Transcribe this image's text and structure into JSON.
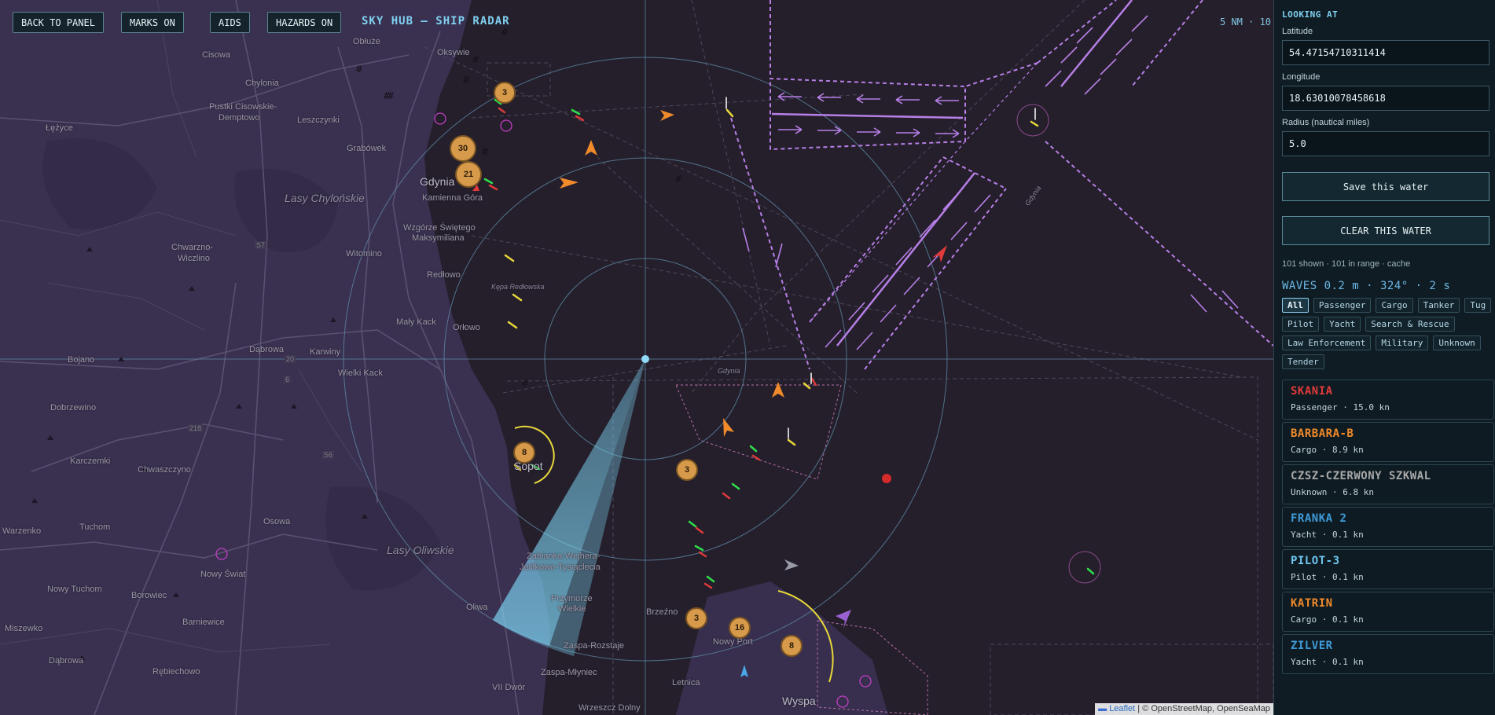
{
  "toolbar": {
    "back_label": "BACK TO PANEL",
    "marks_label": "MARKS ON",
    "aids_label": "AIDS",
    "hazards_label": "HAZARDS ON",
    "app_title": "SKY HUB — SHIP RADAR",
    "range_readout": "5 NM · 10"
  },
  "map": {
    "places": {
      "obluze": "Obłuże",
      "oksywie": "Oksywie",
      "cisowa": "Cisowa",
      "chylonia": "Chylonia",
      "pustki": "Pustki Cisowskie-",
      "demptowo": "Demptowo",
      "leszczynki": "Leszczynki",
      "lezyce": "Łężyce",
      "grabowek": "Grabówek",
      "gdynia": "Gdynia",
      "kamienna_gora": "Kamienna Góra",
      "lasy_chylonskie": "Lasy Chylońskie",
      "wzgorze": "Wzgórze Świętego",
      "maksymiliana": "Maksymiliana",
      "chwarzno": "Chwarzno-",
      "wiczlino": "Wiczlino",
      "witomino": "Witomino",
      "redlowo": "Redłowo",
      "kepa": "Kępa Redłowska",
      "maly_kack": "Mały Kack",
      "orlowo": "Orłowo",
      "dabrowa1": "Dąbrowa",
      "karwiny": "Karwiny",
      "bojano": "Bojano",
      "wielki_kack": "Wielki Kack",
      "dobrzewino": "Dobrzewino",
      "karczemki": "Karczemki",
      "chwaszczyno": "Chwaszczyno",
      "sopot": "Sopot",
      "warzenko": "Warzenko",
      "tuchom": "Tuchom",
      "osowa": "Osowa",
      "lasy_oliwskie": "Lasy Oliwskie",
      "nowy_swiat": "Nowy Świat",
      "nowy_tuchom": "Nowy Tuchom",
      "borowiec": "Borowiec",
      "barniewice": "Barniewice",
      "miszewko": "Miszewko",
      "dabrowa2": "Dąbrowa",
      "rebiechowo": "Rębiechowo",
      "zabianka": "Zabianka-Wejhera-",
      "jelitkowo": "Jelitkowo-Tysiąclecia",
      "przymorze": "Przymorze",
      "wielkie": "Wielkie",
      "oliwa": "Oliwa",
      "brzezno": "Brzeźno",
      "zaspa_rozstaje": "Zaspa-Rozstaje",
      "zaspa_mlyniec": "Zaspa-Młyniec",
      "nowy_port": "Nowy Port",
      "vii_dwor": "VII Dwór",
      "letnica": "Letnica",
      "wrzeszcz": "Wrzeszcz Dolny",
      "wyspa": "Wyspa",
      "gdynia_small": "Gdynia",
      "gdynia_small2": "Gdynia",
      "road_s7": "S7",
      "road_s6": "S6",
      "road_6": "6",
      "road_20": "20",
      "road_218": "218"
    },
    "clusters": [
      "3",
      "30",
      "21",
      "8",
      "3",
      "3",
      "16",
      "8"
    ],
    "attribution": {
      "leaflet": "Leaflet",
      "rest": " | © OpenStreetMap, OpenSeaMap"
    },
    "colors": {
      "sea": "#251f2c",
      "land": "#3a3151",
      "route": "#b77fe6",
      "radar": "#7fd0f0",
      "cluster": "#d79a4a"
    }
  },
  "panel": {
    "looking_at": "LOOKING AT",
    "lat_label": "Latitude",
    "lat_value": "54.47154710311414",
    "lon_label": "Longitude",
    "lon_value": "18.63010078458618",
    "radius_label": "Radius (nautical miles)",
    "radius_value": "5.0",
    "save_label": "Save this water",
    "clear_label": "CLEAR THIS WATER",
    "status": "101 shown · 101 in range · cache",
    "waves": "WAVES 0.2 m · 324° · 2 s",
    "filters": [
      "All",
      "Passenger",
      "Cargo",
      "Tanker",
      "Tug",
      "Pilot",
      "Yacht",
      "Search & Rescue",
      "Law Enforcement",
      "Military",
      "Unknown",
      "Tender"
    ],
    "active_filter": "All",
    "ships": [
      {
        "name": "SKANIA",
        "info": "Passenger · 15.0 kn",
        "color": "#e03a3a"
      },
      {
        "name": "BARBARA-B",
        "info": "Cargo · 8.9 kn",
        "color": "#f08a2a"
      },
      {
        "name": "CZSZ-CZERWONY SZKWAL",
        "info": "Unknown · 6.8 kn",
        "color": "#a8a8a8"
      },
      {
        "name": "FRANKA 2",
        "info": "Yacht · 0.1 kn",
        "color": "#3f9ad8"
      },
      {
        "name": "PILOT-3",
        "info": "Pilot · 0.1 kn",
        "color": "#6ec6f0"
      },
      {
        "name": "KATRIN",
        "info": "Cargo · 0.1 kn",
        "color": "#f08a2a"
      },
      {
        "name": "ZILVER",
        "info": "Yacht · 0.1 kn",
        "color": "#3f9ad8"
      }
    ]
  }
}
